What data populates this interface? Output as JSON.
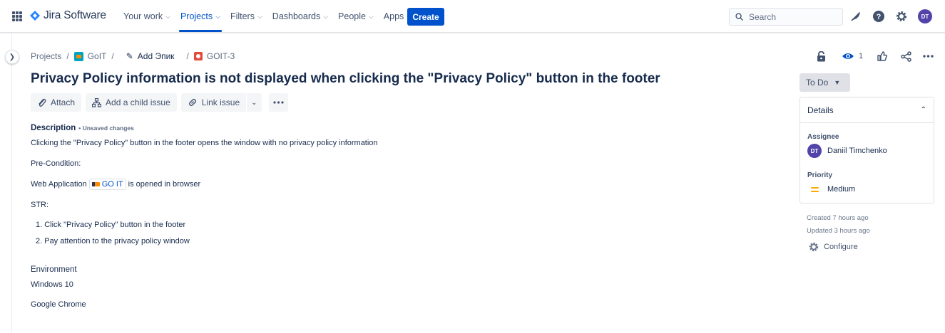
{
  "nav": {
    "logo_text": "Jira Software",
    "items": [
      {
        "label": "Your work"
      },
      {
        "label": "Projects"
      },
      {
        "label": "Filters"
      },
      {
        "label": "Dashboards"
      },
      {
        "label": "People"
      },
      {
        "label": "Apps"
      }
    ],
    "create_label": "Create",
    "search_placeholder": "Search",
    "avatar_initials": "DT"
  },
  "breadcrumb": {
    "projects": "Projects",
    "project": "GoIT",
    "epic": "Add Эпик",
    "issue_key": "GOIT-3"
  },
  "header_actions": {
    "watchers_count": "1"
  },
  "issue": {
    "title": "Privacy Policy information is not displayed when clicking the \"Privacy Policy\" button in the footer"
  },
  "actions": {
    "attach": "Attach",
    "child_issue": "Add a child issue",
    "link_issue": "Link issue"
  },
  "description": {
    "label": "Description",
    "unsaved": "• Unsaved changes",
    "line1": "Clicking the \"Privacy Policy\" button in the footer opens the window with no privacy policy information",
    "precondition": "Pre-Condition:",
    "web_app_prefix": "Web Application",
    "web_app_link": "GO IT",
    "web_app_suffix": "is opened in browser",
    "str": "STR:",
    "steps": [
      "1. Click \"Privacy Policy\" button in the footer",
      "2. Pay attention to the privacy policy window"
    ]
  },
  "environment": {
    "label": "Environment",
    "os": "Windows 10",
    "browser": "Google Chrome"
  },
  "sidepanel": {
    "status": "To Do",
    "details_label": "Details",
    "assignee_label": "Assignee",
    "assignee_initials": "DT",
    "assignee_name": "Daniil Timchenko",
    "priority_label": "Priority",
    "priority_value": "Medium",
    "created": "Created 7 hours ago",
    "updated": "Updated 3 hours ago",
    "configure": "Configure"
  },
  "colors": {
    "accent": "#0052cc",
    "avatar": "#5243aa",
    "priority_medium": "#ffab00"
  }
}
